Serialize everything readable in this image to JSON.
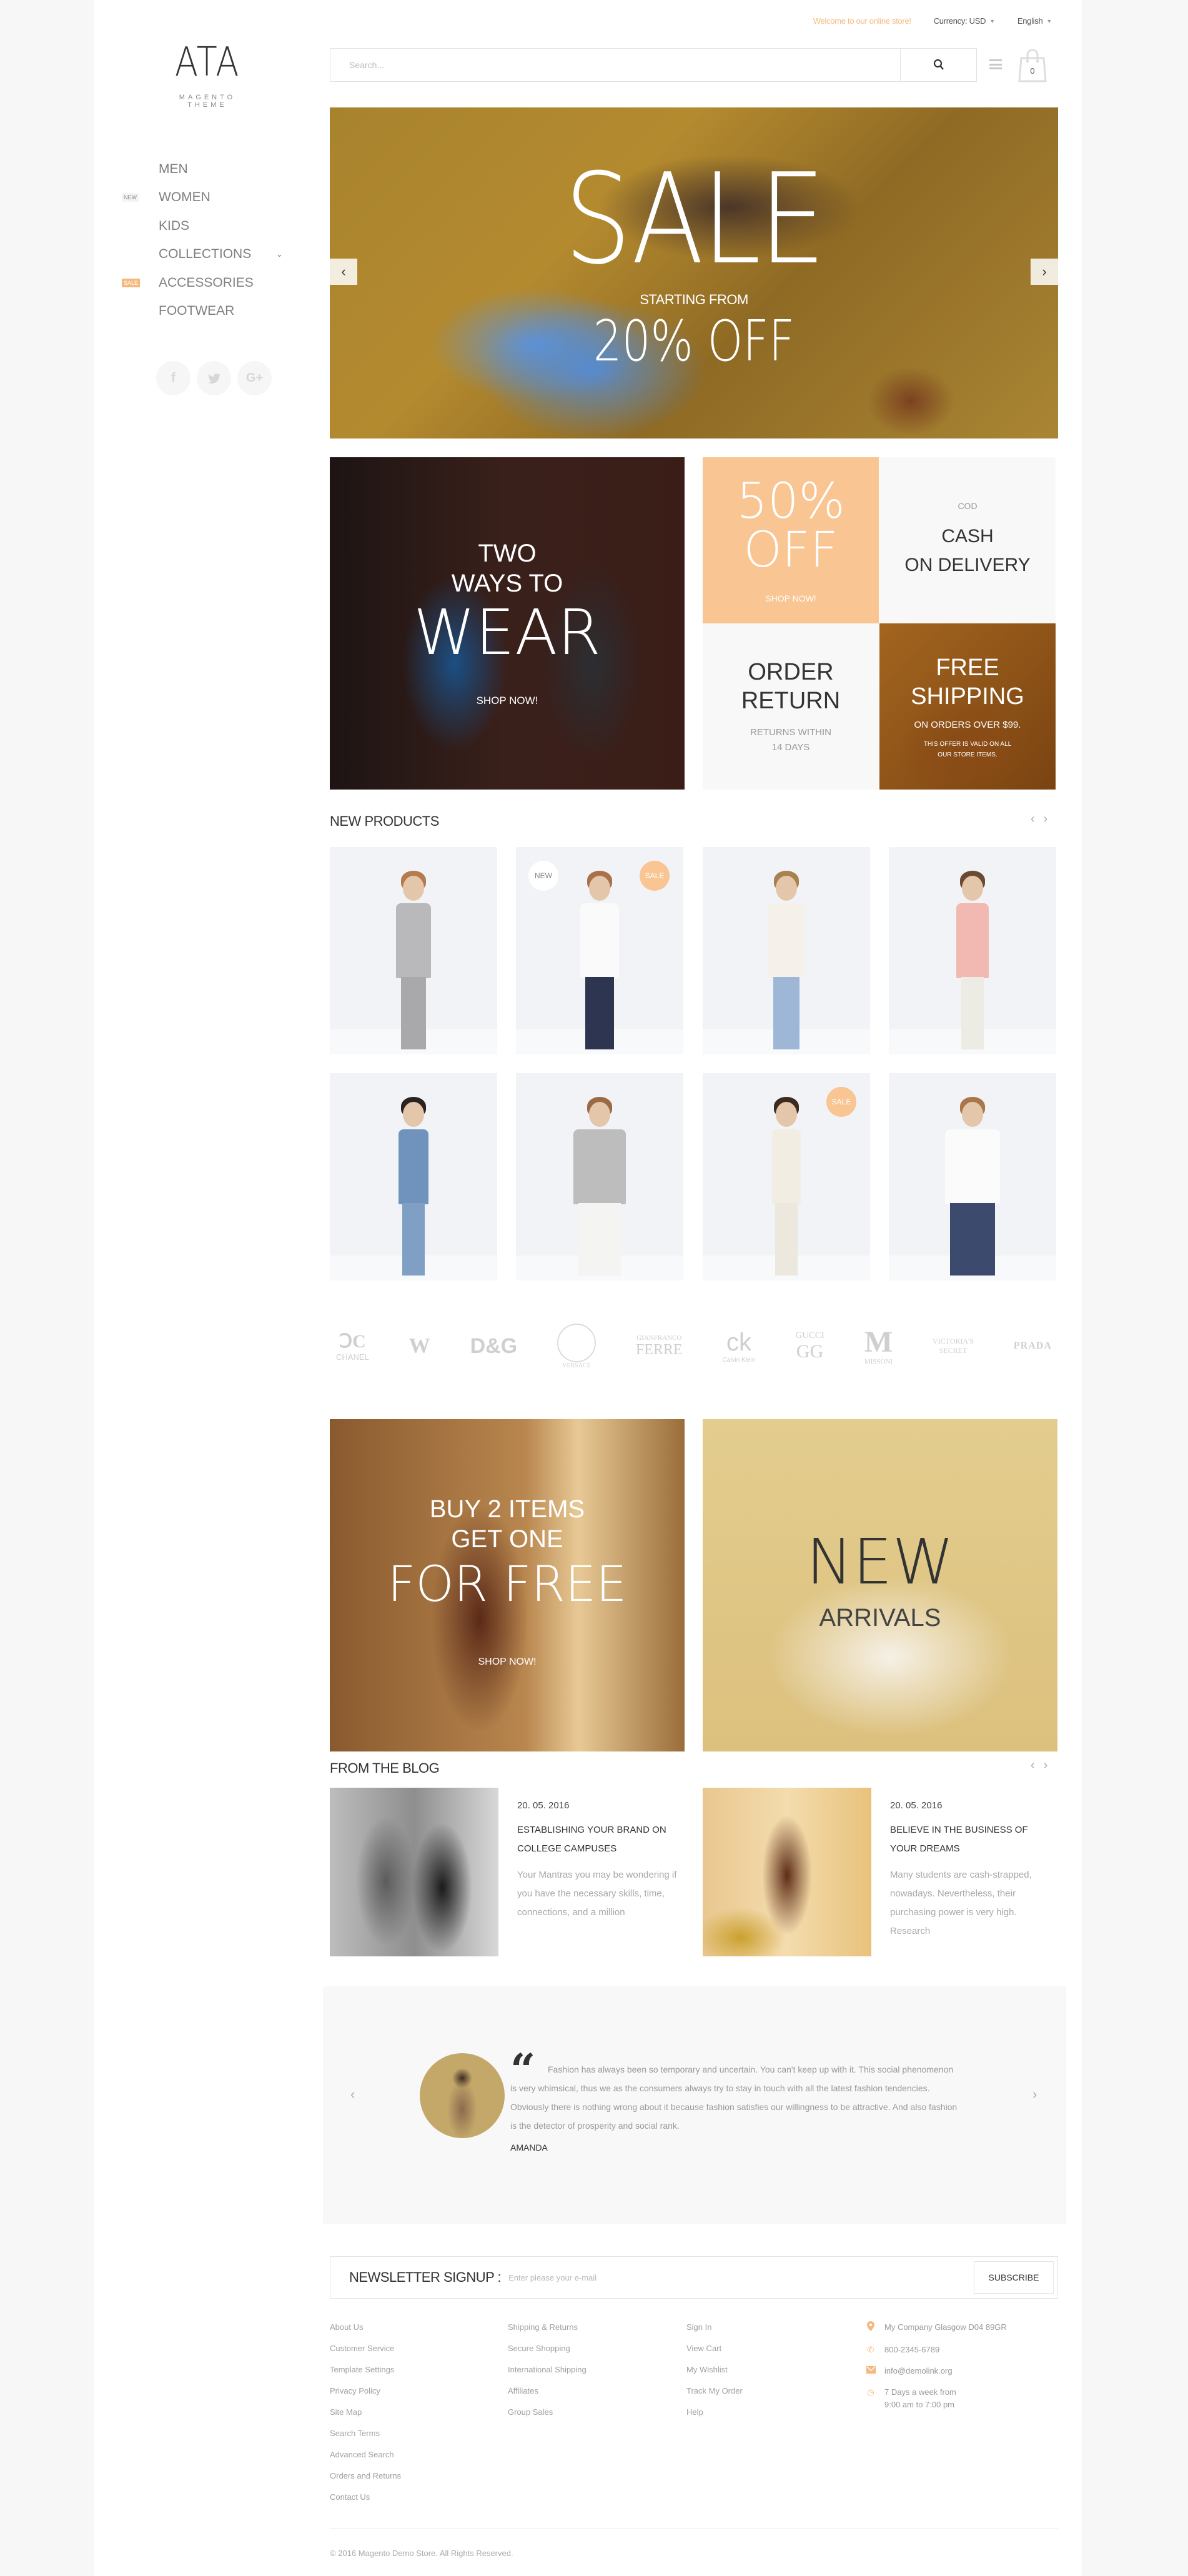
{
  "topbar": {
    "welcome": "Welcome to our online store!",
    "currency_label": "Currency: USD",
    "language_label": "English"
  },
  "logo": {
    "mark": "ATA",
    "subtitle": "MAGENTO THEME"
  },
  "search": {
    "placeholder": "Search...",
    "value": ""
  },
  "cart": {
    "count": "0"
  },
  "nav": {
    "items": [
      {
        "label": "MEN",
        "badge": ""
      },
      {
        "label": "WOMEN",
        "badge": "NEW"
      },
      {
        "label": "KIDS",
        "badge": ""
      },
      {
        "label": "COLLECTIONS",
        "badge": "",
        "has_dropdown": true
      },
      {
        "label": "ACCESSORIES",
        "badge": "SALE"
      },
      {
        "label": "FOOTWEAR",
        "badge": ""
      }
    ]
  },
  "social": [
    "facebook",
    "twitter",
    "google-plus"
  ],
  "hero": {
    "title": "SALE",
    "subtitle": "STARTING FROM",
    "discount": "20% OFF"
  },
  "promos": {
    "wear": {
      "line1": "TWO",
      "line2": "WAYS TO",
      "line3": "WEAR",
      "cta": "SHOP NOW!"
    },
    "off": {
      "line1": "50%",
      "line2": "OFF",
      "cta": "SHOP NOW!"
    },
    "cod": {
      "small": "COD",
      "line1": "CASH",
      "line2": "ON DELIVERY"
    },
    "returns": {
      "line1": "ORDER",
      "line2": "RETURN",
      "sub1": "RETURNS WITHIN",
      "sub2": "14 DAYS"
    },
    "shipping": {
      "line1": "FREE",
      "line2": "SHIPPING",
      "sub": "ON ORDERS OVER $99.",
      "note1": "THIS OFFER IS VALID ON ALL",
      "note2": "OUR STORE ITEMS."
    }
  },
  "new_products": {
    "title": "NEW PRODUCTS",
    "items": [
      {
        "name": "Grey suit",
        "badges": []
      },
      {
        "name": "White blouse and navy shorts",
        "badges": [
          "NEW",
          "SALE"
        ]
      },
      {
        "name": "Cream shirt and wide jeans",
        "badges": []
      },
      {
        "name": "Striped pink tee",
        "badges": []
      },
      {
        "name": "Denim shirt and jeans",
        "badges": []
      },
      {
        "name": "Grey blazer",
        "badges": []
      },
      {
        "name": "White top and trousers",
        "badges": [
          "SALE"
        ]
      },
      {
        "name": "White crop top",
        "badges": []
      }
    ]
  },
  "brands": [
    "CHANEL",
    "EMPORIO ARMANI",
    "D&G",
    "VERSACE",
    "GIANFRANCO FERRE",
    "Calvin Klein",
    "GUCCI",
    "MISSONI",
    "VICTORIA'S SECRET",
    "PRADA"
  ],
  "banners": {
    "free": {
      "line1": "BUY 2 ITEMS",
      "line2": "GET ONE",
      "line3": "FOR FREE",
      "cta": "SHOP NOW!"
    },
    "arrivals": {
      "line1": "NEW",
      "line2": "ARRIVALS"
    }
  },
  "blog": {
    "title": "FROM THE BLOG",
    "posts": [
      {
        "date": "20. 05. 2016",
        "title": "ESTABLISHING YOUR BRAND ON COLLEGE CAMPUSES",
        "excerpt": "Your Mantras you may be wondering if you have the necessary skills, time, connections, and a million"
      },
      {
        "date": "20. 05. 2016",
        "title": "BELIEVE IN THE BUSINESS OF YOUR DREAMS",
        "excerpt": "Many students are cash-strapped, nowadays. Nevertheless, their purchasing power is very high. Research"
      }
    ]
  },
  "testimonial": {
    "quote_mark": "“",
    "text": "Fashion has always been so temporary and uncertain. You can't keep up with it. This social phenomenon is very whimsical, thus we as the consumers always try to stay in touch with all the latest fashion tendencies. Obviously there is nothing wrong about it because fashion satisfies our willingness to be attractive. And also fashion is the detector of prosperity and social rank.",
    "author": "AMANDA"
  },
  "newsletter": {
    "label": "NEWSLETTER SIGNUP :",
    "placeholder": "Enter please your e-mail",
    "button": "SUBSCRIBE"
  },
  "footer": {
    "col1": [
      "About Us",
      "Customer Service",
      "Template Settings",
      "Privacy Policy",
      "Site Map",
      "Search Terms",
      "Advanced Search",
      "Orders and Returns",
      "Contact Us"
    ],
    "col2": [
      "Shipping & Returns",
      "Secure Shopping",
      "International Shipping",
      "Affiliates",
      "Group Sales"
    ],
    "col3": [
      "Sign In",
      "View Cart",
      "My Wishlist",
      "Track My Order",
      "Help"
    ],
    "contact": {
      "address": "My Company Glasgow D04 89GR",
      "phone": "800-2345-6789",
      "email": "info@demolink.org",
      "hours1": "7 Days a week from",
      "hours2": "9:00 am to 7:00 pm"
    },
    "copyright": "© 2016 Magento Demo Store. All Rights Reserved."
  },
  "colors": {
    "accent": "#f9c592",
    "accent_text": "#f5b97f",
    "text": "#333333",
    "muted": "#a0a0a0",
    "page_bg": "#f7f7f7"
  }
}
